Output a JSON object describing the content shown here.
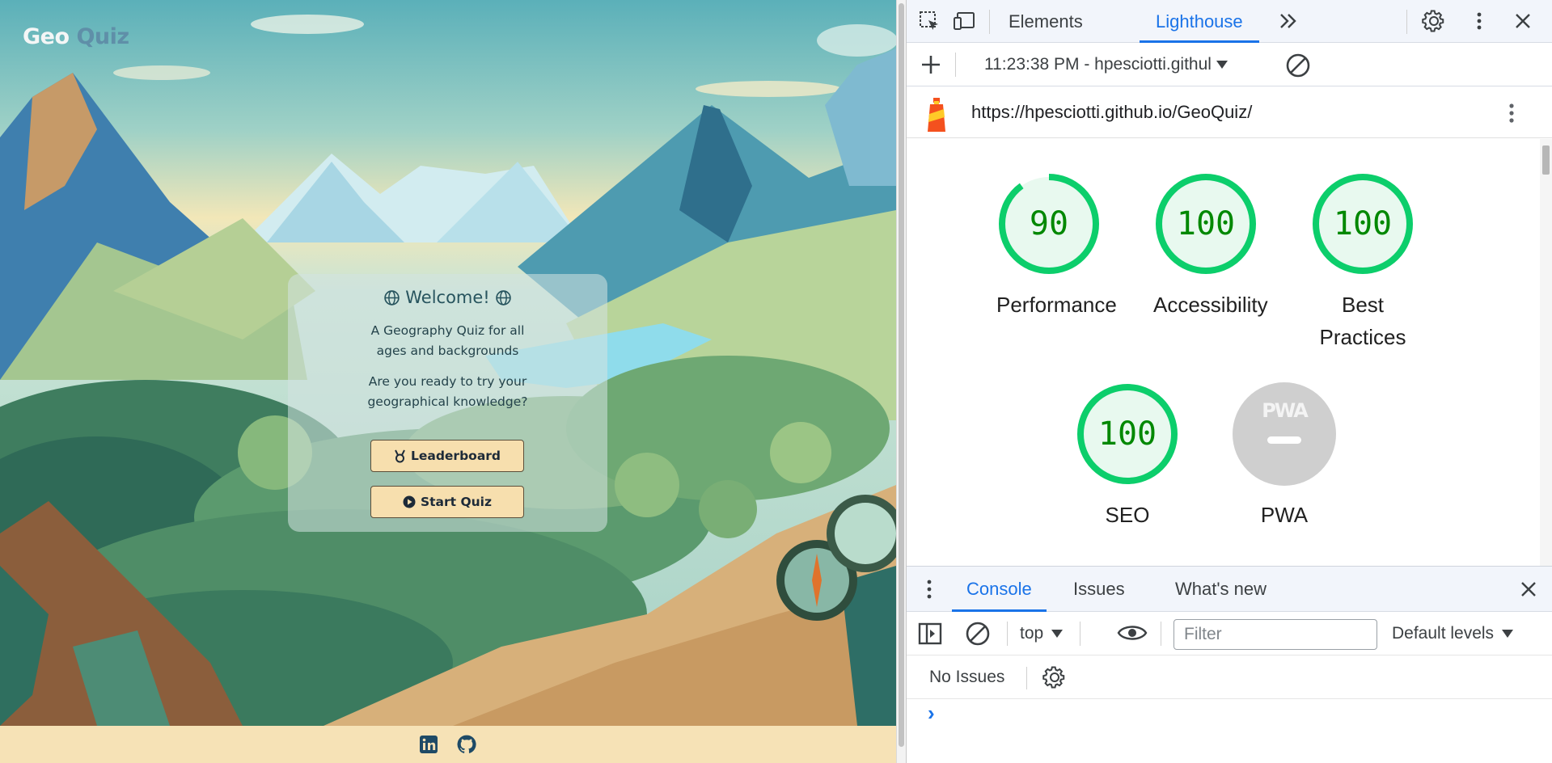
{
  "website": {
    "brand_part1": "Geo",
    "brand_part2": "Quiz",
    "welcome": {
      "title": "Welcome!",
      "text1": "A Geography Quiz for all ages and backgrounds",
      "text2": "Are you ready to try your geographical knowledge?",
      "leaderboard_label": "Leaderboard",
      "start_label": "Start Quiz"
    },
    "footer": {
      "icons": [
        "linkedin-icon",
        "github-icon"
      ]
    }
  },
  "devtools": {
    "tabs": [
      "Elements",
      "Lighthouse"
    ],
    "active_tab": "Lighthouse",
    "report_selector": "11:23:38 PM - hpesciotti.githul",
    "report_url": "https://hpesciotti.github.io/GeoQuiz/",
    "scores": [
      {
        "label": "Performance",
        "score": 90
      },
      {
        "label": "Accessibility",
        "score": 100
      },
      {
        "label": "Best Practices",
        "score": 100
      },
      {
        "label": "SEO",
        "score": 100
      },
      {
        "label": "PWA",
        "score": null,
        "badge": "PWA"
      }
    ],
    "drawer": {
      "tabs": [
        "Console",
        "Issues",
        "What's new"
      ],
      "active_tab": "Console",
      "context": "top",
      "filter_placeholder": "Filter",
      "levels": "Default levels",
      "issues_text": "No Issues",
      "prompt": "›"
    }
  },
  "colors": {
    "score_good": "#0cce6b",
    "score_good_text": "#008800",
    "score_good_fill": "#e8f9ef",
    "pwa_gray": "#cfcfcf",
    "devtools_accent": "#1a73e8",
    "button_bg": "#f7dfae",
    "footer_bg": "#f6e2b6"
  }
}
